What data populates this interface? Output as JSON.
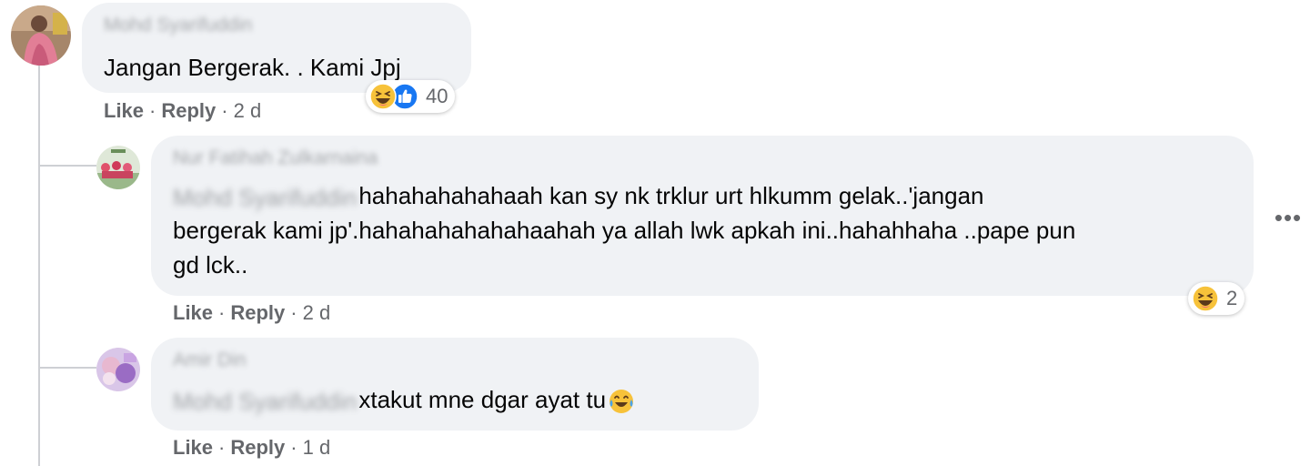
{
  "comments": [
    {
      "author": "Mohd Syarifuddin",
      "text": "Jangan Bergerak. . Kami Jpj",
      "actions": {
        "like": "Like",
        "reply": "Reply",
        "separator": "·",
        "time": "2 d"
      },
      "reactions": {
        "icons": [
          "haha-icon",
          "like-icon"
        ],
        "count": "40"
      }
    },
    {
      "author": "Nur Fatihah Zulkarnaina",
      "mention": "Mohd Syarifuddin",
      "lines": [
        "hahahahahahaah kan sy nk trklur urt hlkumm gelak..'jangan",
        "bergerak kami jp'.hahahahahahahaahah ya allah lwk apkah ini..hahahhaha ..pape pun",
        "gd lck.."
      ],
      "actions": {
        "like": "Like",
        "reply": "Reply",
        "separator": "·",
        "time": "2 d"
      },
      "reactions": {
        "icons": [
          "haha-icon"
        ],
        "count": "2"
      },
      "more": "•••"
    },
    {
      "author": "Amir Din",
      "mention": "Mohd Syarifuddin",
      "text": "xtakut mne dgar ayat tu",
      "actions": {
        "like": "Like",
        "reply": "Reply",
        "separator": "·",
        "time": "1 d"
      }
    }
  ],
  "colors": {
    "bubble": "#f0f2f5",
    "text": "#050505",
    "meta": "#65676b",
    "thread_line": "#ced0d4",
    "like_blue": "#1877f2",
    "haha_yellow": "#f7c23a"
  }
}
